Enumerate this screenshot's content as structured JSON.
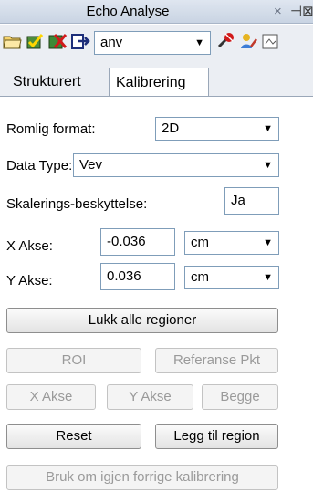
{
  "window": {
    "title": "Echo Analyse",
    "close_glyph": "×",
    "pin_glyph": "⊣⊠"
  },
  "toolbar": {
    "icons": [
      "open-folder-icon",
      "save-check-icon",
      "delete-red-icon",
      "export-icon",
      "tools-red-icon",
      "edit-person-icon",
      "calendar-icon"
    ],
    "combo_value": "anv"
  },
  "tabs": [
    {
      "label": "Strukturert",
      "active": false
    },
    {
      "label": "Kalibrering",
      "active": true
    }
  ],
  "form": {
    "romlig_label": "Romlig format:",
    "romlig_value": "2D",
    "datatype_label": "Data Type:",
    "datatype_value": "Vev",
    "skalering_label": "Skalerings-beskyttelse:",
    "skalering_value": "Ja",
    "xakse_label": "X Akse:",
    "xakse_value": "-0.036",
    "xakse_unit": "cm",
    "yakse_label": "Y Akse:",
    "yakse_value": "0.036",
    "yakse_unit": "cm"
  },
  "buttons": {
    "lukk": "Lukk alle regioner",
    "roi": "ROI",
    "referanse": "Referanse Pkt",
    "xakse": "X Akse",
    "yakse": "Y Akse",
    "begge": "Begge",
    "reset": "Reset",
    "legg_til": "Legg til region",
    "bruk_om_igjen": "Bruk om igjen forrige kalibrering"
  },
  "colors": {
    "titlebar": "#c9d4e3",
    "toolbar": "#ebeef3",
    "disabled_text": "#9a9a9a"
  }
}
